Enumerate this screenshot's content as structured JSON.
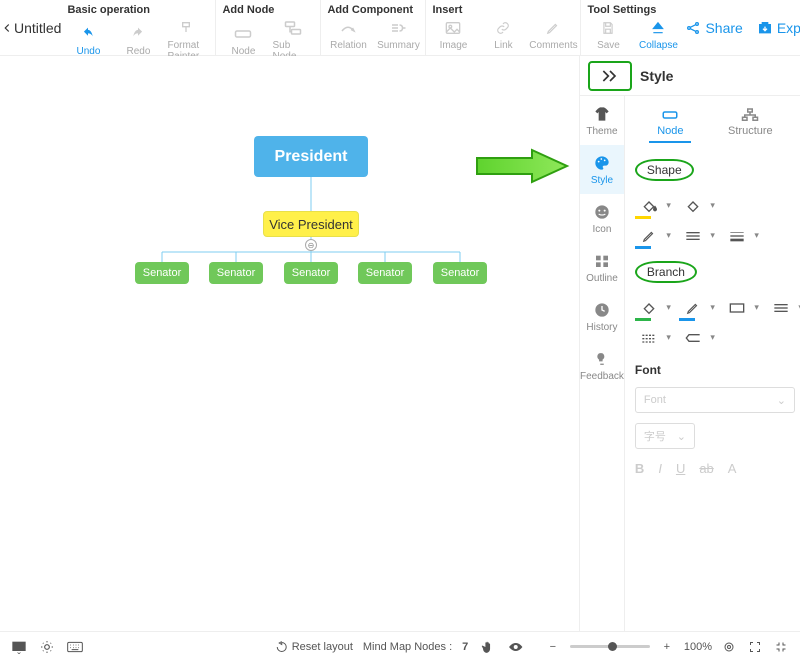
{
  "header": {
    "title": "Untitled",
    "groups": {
      "basic": {
        "label": "Basic operation",
        "undo": "Undo",
        "redo": "Redo",
        "format_painter": "Format Painter"
      },
      "add_node": {
        "label": "Add Node",
        "node": "Node",
        "sub_node": "Sub Node"
      },
      "add_component": {
        "label": "Add Component",
        "relation": "Relation",
        "summary": "Summary"
      },
      "insert": {
        "label": "Insert",
        "image": "Image",
        "link": "Link",
        "comments": "Comments"
      },
      "tool_settings": {
        "label": "Tool Settings",
        "save": "Save",
        "collapse": "Collapse"
      }
    },
    "share": "Share",
    "export": "Export"
  },
  "mindmap": {
    "president": "President",
    "vice_president": "Vice President",
    "senators": [
      "Senator",
      "Senator",
      "Senator",
      "Senator",
      "Senator"
    ]
  },
  "rpanel": {
    "title": "Style",
    "vtabs": {
      "theme": "Theme",
      "style": "Style",
      "icon": "Icon",
      "outline": "Outline",
      "history": "History",
      "feedback": "Feedback"
    },
    "subtabs": {
      "node": "Node",
      "structure": "Structure"
    },
    "sections": {
      "shape": "Shape",
      "branch": "Branch",
      "font": "Font"
    },
    "font_select": "Font",
    "size_select": "字号"
  },
  "bottom": {
    "reset_layout": "Reset layout",
    "nodes_label": "Mind Map Nodes :",
    "nodes_count": "7",
    "zoom": "100%"
  }
}
